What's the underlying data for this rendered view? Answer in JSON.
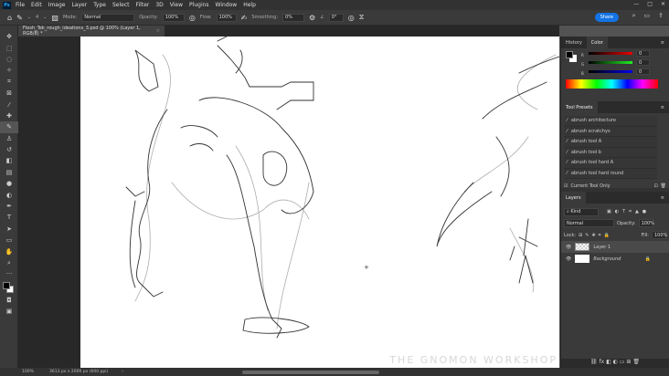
{
  "app": {
    "logo": "Ps",
    "menus": [
      "File",
      "Edit",
      "Image",
      "Layer",
      "Type",
      "Select",
      "Filter",
      "3D",
      "View",
      "Plugins",
      "Window",
      "Help"
    ],
    "share": "Share"
  },
  "options": {
    "mode_label": "Mode:",
    "mode": "Normal",
    "opacity_label": "Opacity:",
    "opacity": "100%",
    "flow_label": "Flow:",
    "flow": "100%",
    "smoothing_label": "Smoothing:",
    "smoothing": "0%",
    "angle": "0°",
    "brush_size": "4"
  },
  "document": {
    "tab": "Flesh_Tek_rough_ideations_3.psd @ 100% (Layer 1, RGB/8) *"
  },
  "color_panel": {
    "tabs": [
      "History",
      "Color"
    ],
    "r": "0",
    "g": "0",
    "b": "0",
    "r_label": "R",
    "g_label": "G",
    "b_label": "B"
  },
  "tool_presets": {
    "title": "Tool Presets",
    "items": [
      "abrush architecture",
      "abrush scratchys",
      "abrush tool A",
      "abrush tool b",
      "abrush tool hard A",
      "abrush tool hard round"
    ],
    "current_only": "Current Tool Only"
  },
  "layers": {
    "title": "Layers",
    "filter": "Kind",
    "blend": "Normal",
    "opacity_label": "Opacity:",
    "opacity": "100%",
    "lock_label": "Lock:",
    "fill_label": "Fill:",
    "fill": "100%",
    "items": [
      "Layer 1",
      "Background"
    ]
  },
  "status": {
    "zoom": "100%",
    "size": "3613 px x 2000 px (600 ppi)"
  },
  "watermark": "THE GNOMON WORKSHOP"
}
